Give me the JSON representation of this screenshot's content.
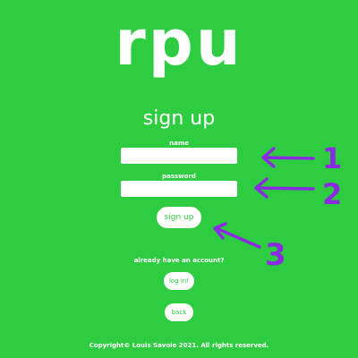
{
  "app": {
    "logo_text": "rpu"
  },
  "form": {
    "title": "sign up",
    "name_label": "name",
    "name_value": "",
    "password_label": "password",
    "password_value": "",
    "submit_label": "sign up"
  },
  "account": {
    "prompt": "already have an account?",
    "login_label": "log in!",
    "back_label": "back"
  },
  "footer": {
    "text": "Copyright© Louis Savoie 2021. All rights reserved."
  },
  "annotations": {
    "numbers": [
      "1",
      "2",
      "3"
    ],
    "color": "#8a2be2"
  },
  "theme": {
    "background": "#2ecc40",
    "foreground": "#ffffff",
    "button_text": "#2ecc40"
  }
}
